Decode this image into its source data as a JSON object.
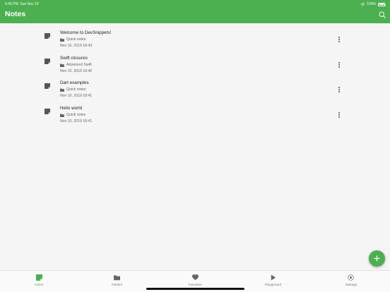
{
  "status": {
    "time": "6:45 PM",
    "date": "Sun Nov 10",
    "battery": "100%"
  },
  "header": {
    "title": "Notes",
    "search_icon": "search-icon"
  },
  "notes": [
    {
      "title": "Welcome to DevSnippets!",
      "folder": "Quick notes",
      "date": "Nov 10, 2019 18:43"
    },
    {
      "title": "Swift closures",
      "folder": "Advanced Swift",
      "date": "Nov 10, 2019 18:42"
    },
    {
      "title": "Dart examples",
      "folder": "Quick notes",
      "date": "Nov 10, 2019 18:41"
    },
    {
      "title": "Hello world",
      "folder": "Quick notes",
      "date": "Nov 10, 2019 18:41"
    }
  ],
  "fab": {
    "icon": "plus-icon"
  },
  "tabs": [
    {
      "label": "Notes",
      "icon": "notes-icon",
      "active": true
    },
    {
      "label": "Folders",
      "icon": "folder-icon",
      "active": false
    },
    {
      "label": "Favorites",
      "icon": "heart-icon",
      "active": false
    },
    {
      "label": "Playground",
      "icon": "play-icon",
      "active": false
    },
    {
      "label": "Settings",
      "icon": "gear-icon",
      "active": false
    }
  ],
  "colors": {
    "accent": "#4caf50",
    "text": "#222222",
    "secondary_text": "#666666",
    "tab_inactive": "#777777",
    "background": "#f5f5f5"
  }
}
